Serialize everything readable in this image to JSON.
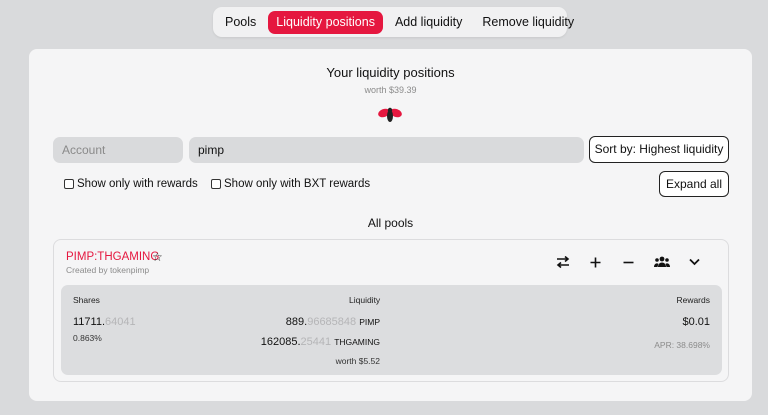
{
  "tabs": [
    {
      "label": "Pools",
      "active": false
    },
    {
      "label": "Liquidity positions",
      "active": true
    },
    {
      "label": "Add liquidity",
      "active": false
    },
    {
      "label": "Remove liquidity",
      "active": false
    }
  ],
  "header": {
    "title": "Your liquidity positions",
    "worth": "worth $39.39"
  },
  "filters": {
    "account_placeholder": "Account",
    "search_value": "pimp",
    "sort_label": "Sort by: Highest liquidity",
    "rewards_only_label": "Show only with rewards",
    "bxt_rewards_only_label": "Show only with BXT rewards",
    "expand_all_label": "Expand all"
  },
  "section_title": "All pools",
  "pool": {
    "name": "PIMP:THGAMING",
    "created_by": "Created by tokenpimp",
    "shares_header": "Shares",
    "liquidity_header": "Liquidity",
    "rewards_header": "Rewards",
    "shares_int": "11711.",
    "shares_frac": "64041",
    "share_percent": "0.863%",
    "liq1_int": "889.",
    "liq1_frac": "96685848",
    "liq1_token": "PIMP",
    "liq2_int": "162085.",
    "liq2_frac": "25441",
    "liq2_token": "THGAMING",
    "liq_worth": "worth $5.52",
    "rewards_value": "$0.01",
    "apr": "APR: 38.698%"
  },
  "colors": {
    "accent": "#e5173f",
    "background": "#d9dadc",
    "card": "#f5f5f6"
  },
  "icons": [
    "swap-icon",
    "plus-icon",
    "minus-icon",
    "users-icon",
    "chevron-down-icon",
    "star-icon",
    "bee-logo-icon"
  ]
}
